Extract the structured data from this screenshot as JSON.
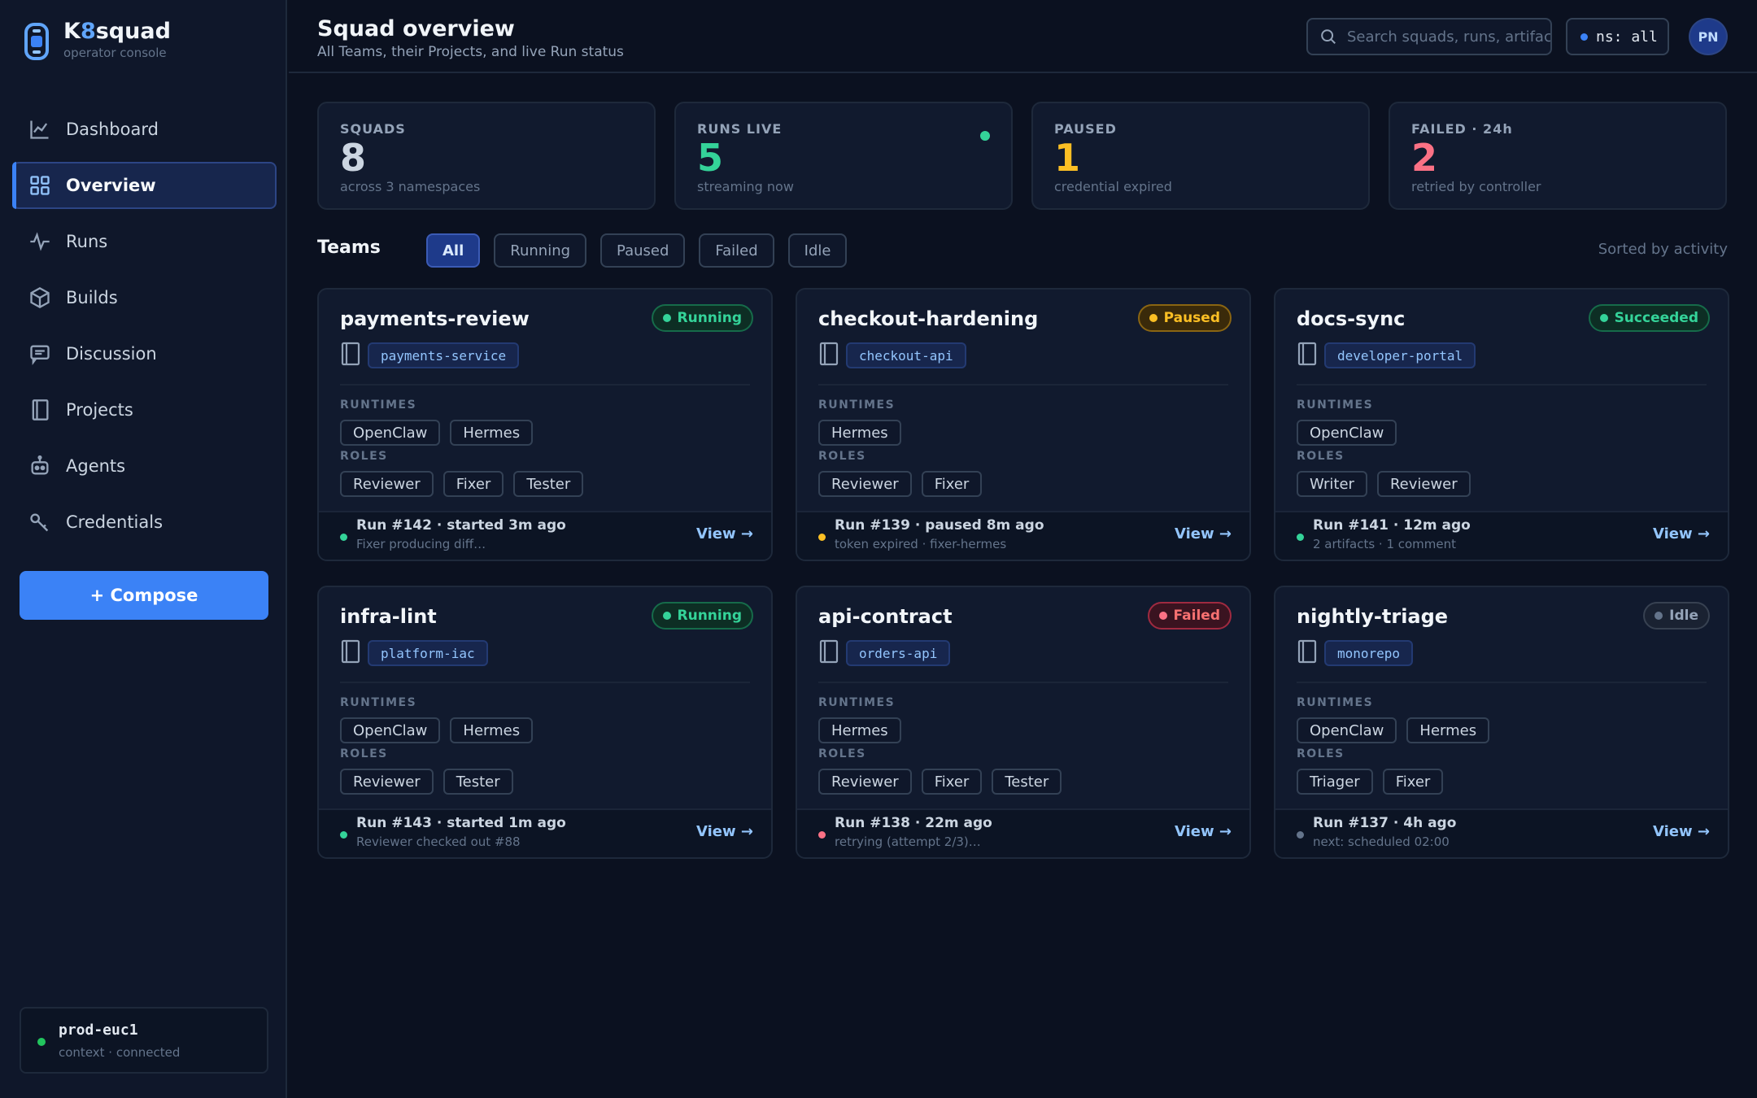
{
  "brand": {
    "name_prefix": "K",
    "name_accent": "8",
    "name_suffix": "squad",
    "subtitle": "operator console"
  },
  "nav": [
    {
      "label": "Dashboard",
      "icon": "chart-line-icon"
    },
    {
      "label": "Overview",
      "icon": "grid-icon",
      "active": true
    },
    {
      "label": "Runs",
      "icon": "activity-icon"
    },
    {
      "label": "Builds",
      "icon": "cube-icon"
    },
    {
      "label": "Discussion",
      "icon": "message-icon"
    },
    {
      "label": "Projects",
      "icon": "book-icon"
    },
    {
      "label": "Agents",
      "icon": "robot-icon"
    },
    {
      "label": "Credentials",
      "icon": "key-icon"
    }
  ],
  "compose_label": "+ Compose",
  "context": {
    "name": "prod-euc1",
    "status": "context · connected"
  },
  "header": {
    "title": "Squad overview",
    "subtitle": "All Teams, their Projects, and live Run status",
    "search_placeholder": "Search squads, runs, artifacts…",
    "namespace": "ns: all",
    "avatar": "PN"
  },
  "stats": [
    {
      "label": "SQUADS",
      "value": "8",
      "sub": "across 3 namespaces",
      "color": "#cbd5e1"
    },
    {
      "label": "RUNS LIVE",
      "value": "5",
      "sub": "streaming now",
      "color": "#34d399",
      "live": true
    },
    {
      "label": "PAUSED",
      "value": "1",
      "sub": "credential expired",
      "color": "#fbbf24"
    },
    {
      "label": "FAILED · 24h",
      "value": "2",
      "sub": "retried by controller",
      "color": "#fb7185"
    }
  ],
  "teams_title": "Teams",
  "filters": [
    "All",
    "Running",
    "Paused",
    "Failed",
    "Idle"
  ],
  "sort_label": "Sorted by activity",
  "labels": {
    "runtimes": "RUNTIMES",
    "roles": "ROLES",
    "view": "View →"
  },
  "cards": [
    {
      "name": "payments-review",
      "status": "Running",
      "status_class": "b-running",
      "project": "payments-service",
      "runtimes": [
        "OpenClaw",
        "Hermes"
      ],
      "roles": [
        "Reviewer",
        "Fixer",
        "Tester"
      ],
      "run_title": "Run #142 · started 3m ago",
      "run_sub": "Fixer producing diff…",
      "run_color": "#34d399"
    },
    {
      "name": "checkout-hardening",
      "status": "Paused",
      "status_class": "b-paused",
      "project": "checkout-api",
      "runtimes": [
        "Hermes"
      ],
      "roles": [
        "Reviewer",
        "Fixer"
      ],
      "run_title": "Run #139 · paused 8m ago",
      "run_sub": "token expired · fixer-hermes",
      "run_color": "#fbbf24"
    },
    {
      "name": "docs-sync",
      "status": "Succeeded",
      "status_class": "b-succeeded",
      "project": "developer-portal",
      "runtimes": [
        "OpenClaw"
      ],
      "roles": [
        "Writer",
        "Reviewer"
      ],
      "run_title": "Run #141 · 12m ago",
      "run_sub": "2 artifacts · 1 comment",
      "run_color": "#34d399"
    },
    {
      "name": "infra-lint",
      "status": "Running",
      "status_class": "b-running",
      "project": "platform-iac",
      "runtimes": [
        "OpenClaw",
        "Hermes"
      ],
      "roles": [
        "Reviewer",
        "Tester"
      ],
      "run_title": "Run #143 · started 1m ago",
      "run_sub": "Reviewer checked out #88",
      "run_color": "#34d399"
    },
    {
      "name": "api-contract",
      "status": "Failed",
      "status_class": "b-failed",
      "project": "orders-api",
      "runtimes": [
        "Hermes"
      ],
      "roles": [
        "Reviewer",
        "Fixer",
        "Tester"
      ],
      "run_title": "Run #138 · 22m ago",
      "run_sub": "retrying (attempt 2/3)…",
      "run_color": "#fb7185"
    },
    {
      "name": "nightly-triage",
      "status": "Idle",
      "status_class": "b-idle",
      "project": "monorepo",
      "runtimes": [
        "OpenClaw",
        "Hermes"
      ],
      "roles": [
        "Triager",
        "Fixer"
      ],
      "run_title": "Run #137 · 4h ago",
      "run_sub": "next: scheduled 02:00",
      "run_color": "#64748b"
    }
  ]
}
